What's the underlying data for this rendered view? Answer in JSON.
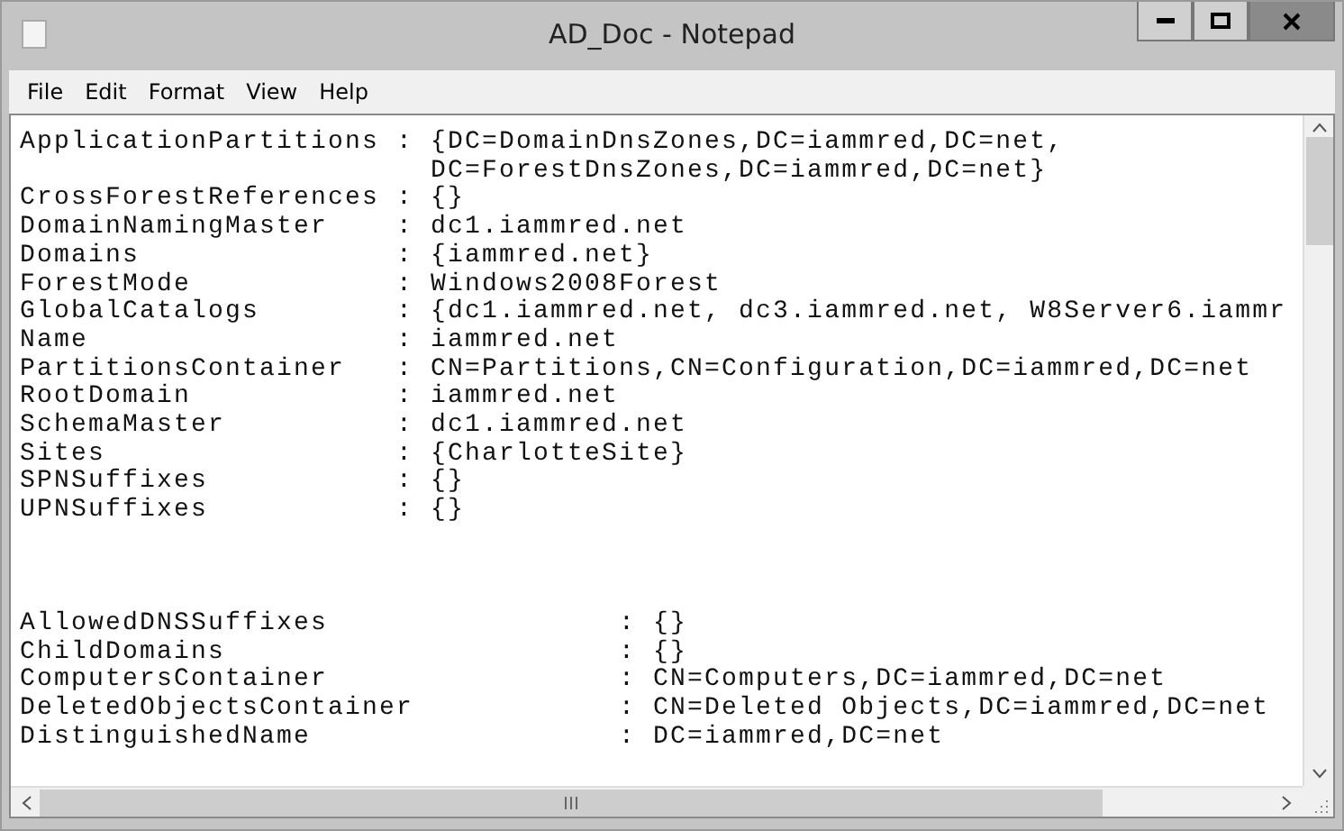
{
  "window": {
    "title": "AD_Doc - Notepad"
  },
  "menu": [
    "File",
    "Edit",
    "Format",
    "View",
    "Help"
  ],
  "document": {
    "sections": [
      {
        "lines": [
          "ApplicationPartitions : {DC=DomainDnsZones,DC=iammred,DC=net,",
          "                        DC=ForestDnsZones,DC=iammred,DC=net}",
          "CrossForestReferences : {}",
          "DomainNamingMaster    : dc1.iammred.net",
          "Domains               : {iammred.net}",
          "ForestMode            : Windows2008Forest",
          "GlobalCatalogs        : {dc1.iammred.net, dc3.iammred.net, W8Server6.iammr",
          "Name                  : iammred.net",
          "PartitionsContainer   : CN=Partitions,CN=Configuration,DC=iammred,DC=net",
          "RootDomain            : iammred.net",
          "SchemaMaster          : dc1.iammred.net",
          "Sites                 : {CharlotteSite}",
          "SPNSuffixes           : {}",
          "UPNSuffixes           : {}"
        ]
      },
      {
        "lines": [
          "AllowedDNSSuffixes                 : {}",
          "ChildDomains                       : {}",
          "ComputersContainer                 : CN=Computers,DC=iammred,DC=net",
          "DeletedObjectsContainer            : CN=Deleted Objects,DC=iammred,DC=net",
          "DistinguishedName                  : DC=iammred,DC=net"
        ]
      }
    ]
  }
}
